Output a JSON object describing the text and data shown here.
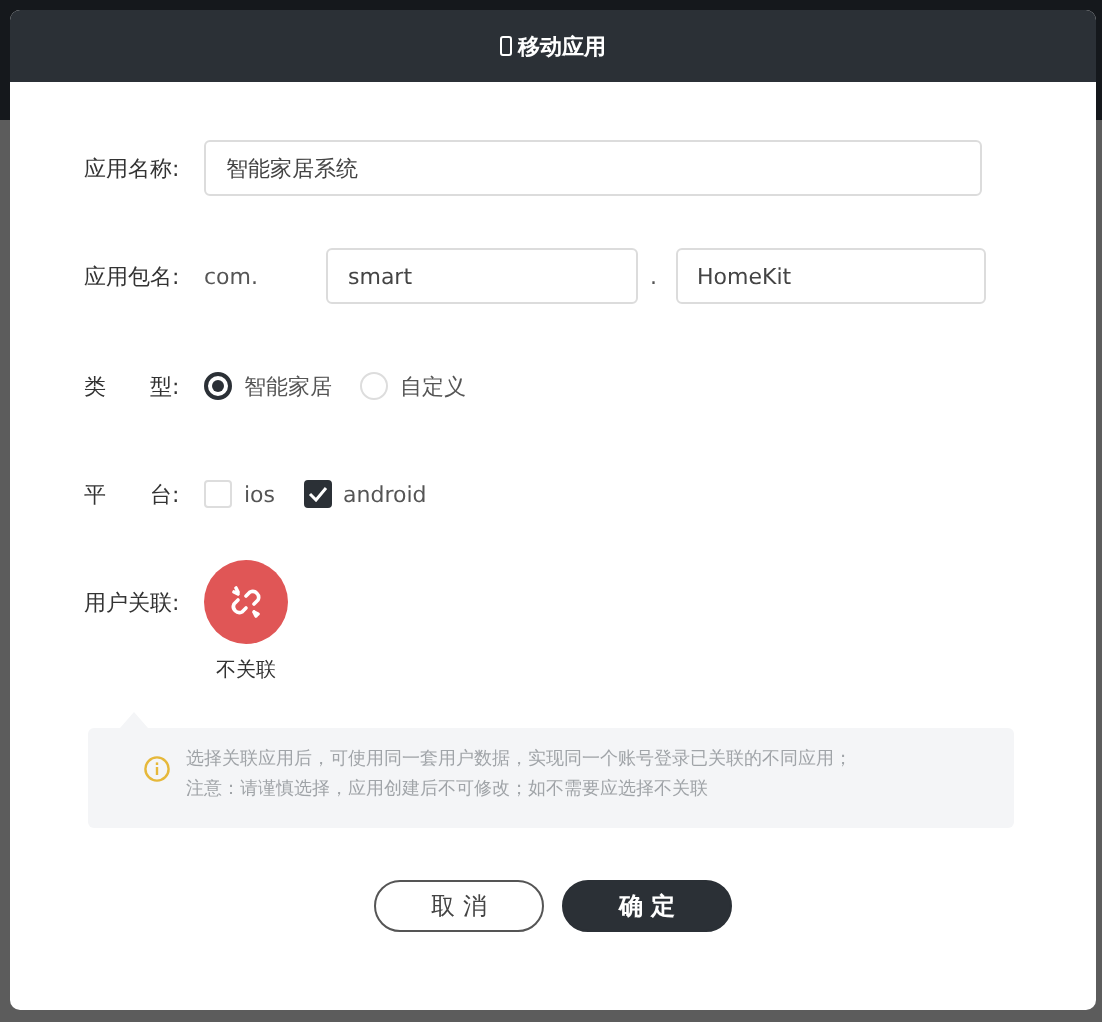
{
  "dialog": {
    "title": "移动应用",
    "name_field": {
      "label": "应用名称:",
      "value": "智能家居系统"
    },
    "package_field": {
      "label": "应用包名:",
      "prefix": "com.",
      "part_1": "smart",
      "separator": ".",
      "part_2": "HomeKit"
    },
    "type_field": {
      "label": "类　　型:",
      "options": [
        {
          "label": "智能家居",
          "selected": true
        },
        {
          "label": "自定义",
          "selected": false
        }
      ]
    },
    "platform_field": {
      "label": "平　　台:",
      "options": [
        {
          "label": "ios",
          "checked": false
        },
        {
          "label": "android",
          "checked": true
        }
      ]
    },
    "user_link": {
      "label": "用户关联:",
      "option_label": "不关联"
    },
    "notice": [
      "选择关联应用后，可使用同一套用户数据，实现同一个账号登录已关联的不同应用；",
      "注意：请谨慎选择，应用创建后不可修改；如不需要应选择不关联"
    ],
    "buttons": [
      {
        "label": "取 消",
        "kind": "secondary"
      },
      {
        "label": "确 定",
        "kind": "primary"
      }
    ]
  }
}
